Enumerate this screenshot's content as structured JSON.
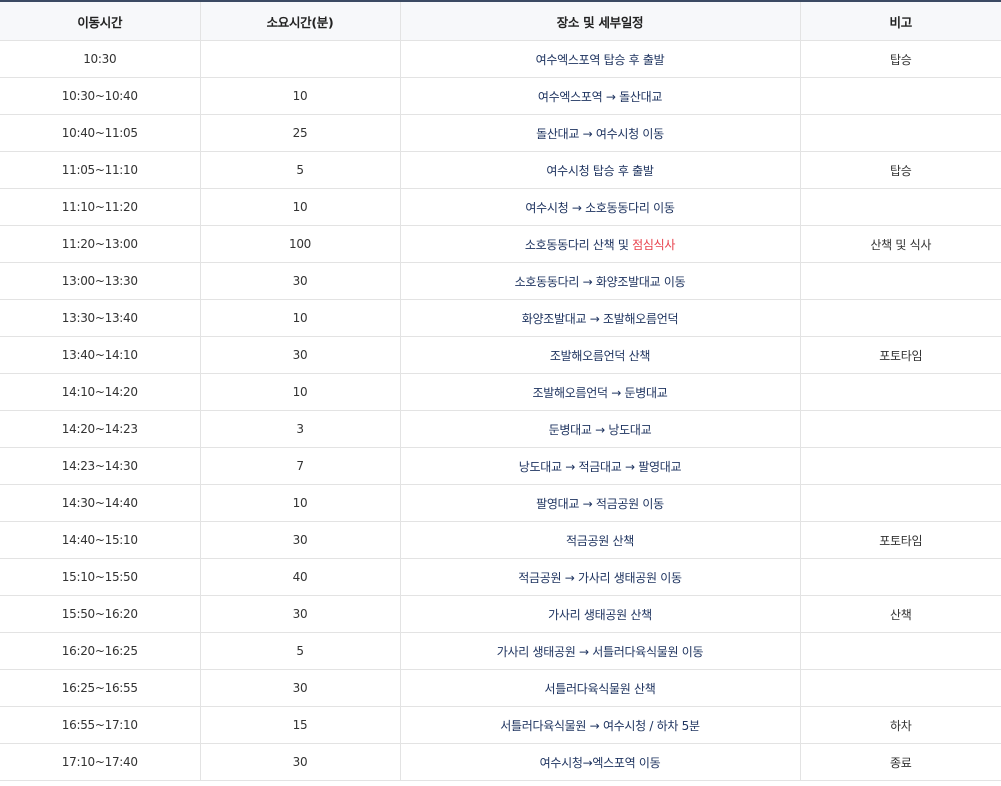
{
  "table": {
    "headers": [
      "이동시간",
      "소요시간(분)",
      "장소 및 세부일정",
      "비고"
    ],
    "rows": [
      {
        "time": "10:30",
        "duration": "",
        "place": "여수엑스포역 탑승 후 출발",
        "place_highlight": "",
        "note": "탑승"
      },
      {
        "time": "10:30~10:40",
        "duration": "10",
        "place": "여수엑스포역 → 돌산대교",
        "place_highlight": "",
        "note": ""
      },
      {
        "time": "10:40~11:05",
        "duration": "25",
        "place": "돌산대교 → 여수시청 이동",
        "place_highlight": "",
        "note": ""
      },
      {
        "time": "11:05~11:10",
        "duration": "5",
        "place": "여수시청 탑승 후 출발",
        "place_highlight": "",
        "note": "탑승"
      },
      {
        "time": "11:10~11:20",
        "duration": "10",
        "place": "여수시청 → 소호동동다리 이동",
        "place_highlight": "",
        "note": ""
      },
      {
        "time": "11:20~13:00",
        "duration": "100",
        "place": "소호동동다리 산책 및 ",
        "place_highlight": "점심식사",
        "note": "산책 및 식사"
      },
      {
        "time": "13:00~13:30",
        "duration": "30",
        "place": "소호동동다리 → 화양조발대교 이동",
        "place_highlight": "",
        "note": ""
      },
      {
        "time": "13:30~13:40",
        "duration": "10",
        "place": "화양조발대교 → 조발해오름언덕",
        "place_highlight": "",
        "note": ""
      },
      {
        "time": "13:40~14:10",
        "duration": "30",
        "place": "조발해오름언덕 산책",
        "place_highlight": "",
        "note": "포토타임"
      },
      {
        "time": "14:10~14:20",
        "duration": "10",
        "place": "조발해오름언덕 → 둔병대교",
        "place_highlight": "",
        "note": ""
      },
      {
        "time": "14:20~14:23",
        "duration": "3",
        "place": "둔병대교 → 낭도대교",
        "place_highlight": "",
        "note": ""
      },
      {
        "time": "14:23~14:30",
        "duration": "7",
        "place": "낭도대교 → 적금대교 → 팔영대교",
        "place_highlight": "",
        "note": ""
      },
      {
        "time": "14:30~14:40",
        "duration": "10",
        "place": "팔영대교 → 적금공원 이동",
        "place_highlight": "",
        "note": ""
      },
      {
        "time": "14:40~15:10",
        "duration": "30",
        "place": "적금공원 산책",
        "place_highlight": "",
        "note": "포토타임"
      },
      {
        "time": "15:10~15:50",
        "duration": "40",
        "place": "적금공원 → 가사리 생태공원 이동",
        "place_highlight": "",
        "note": ""
      },
      {
        "time": "15:50~16:20",
        "duration": "30",
        "place": "가사리 생태공원 산책",
        "place_highlight": "",
        "note": "산책"
      },
      {
        "time": "16:20~16:25",
        "duration": "5",
        "place": "가사리 생태공원 → 서틀러다육식물원 이동",
        "place_highlight": "",
        "note": ""
      },
      {
        "time": "16:25~16:55",
        "duration": "30",
        "place": "서틀러다육식물원 산책",
        "place_highlight": "",
        "note": ""
      },
      {
        "time": "16:55~17:10",
        "duration": "15",
        "place": "서틀러다육식물원 → 여수시청 / 하차 5분",
        "place_highlight": "",
        "note": "하차"
      },
      {
        "time": "17:10~17:40",
        "duration": "30",
        "place": "여수시청→엑스포역 이동",
        "place_highlight": "",
        "note": "종료"
      }
    ]
  },
  "colors": {
    "header_background": "#f7f8fa",
    "top_border": "#3b4a63",
    "place_text": "#1f3460",
    "highlight_text": "#e8414c"
  }
}
